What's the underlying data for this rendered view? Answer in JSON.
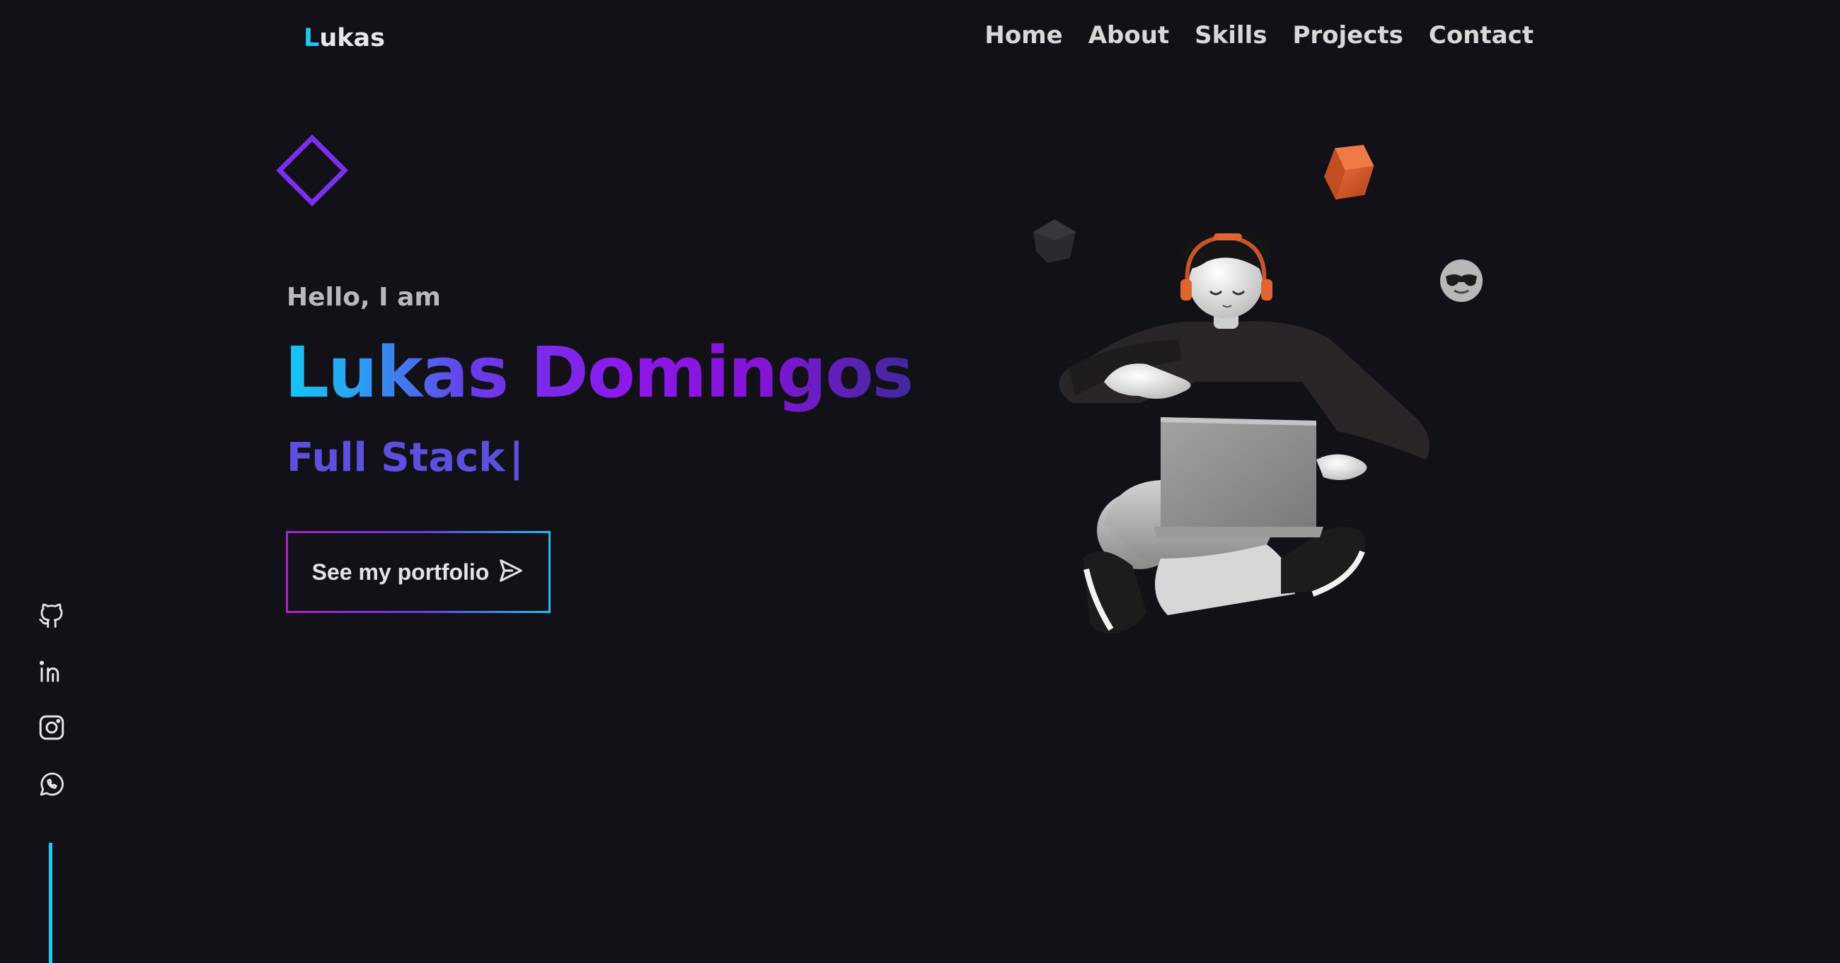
{
  "header": {
    "logo_first": "L",
    "logo_rest": "ukas",
    "nav": [
      "Home",
      "About",
      "Skills",
      "Projects",
      "Contact"
    ]
  },
  "hero": {
    "greeting": "Hello, I am",
    "name": "Lukas Domingos",
    "role": "Full Stack",
    "caret": "|",
    "cta_label": "See my portfolio"
  },
  "social": [
    "github-icon",
    "linkedin-icon",
    "instagram-icon",
    "whatsapp-icon"
  ],
  "colors": {
    "background": "#121118",
    "accent_cyan": "#1ec8f0",
    "accent_purple": "#8d18ea",
    "role_color": "#5d4fe0",
    "diamond": "#7c2ff0",
    "cube": "#d95b2c"
  }
}
